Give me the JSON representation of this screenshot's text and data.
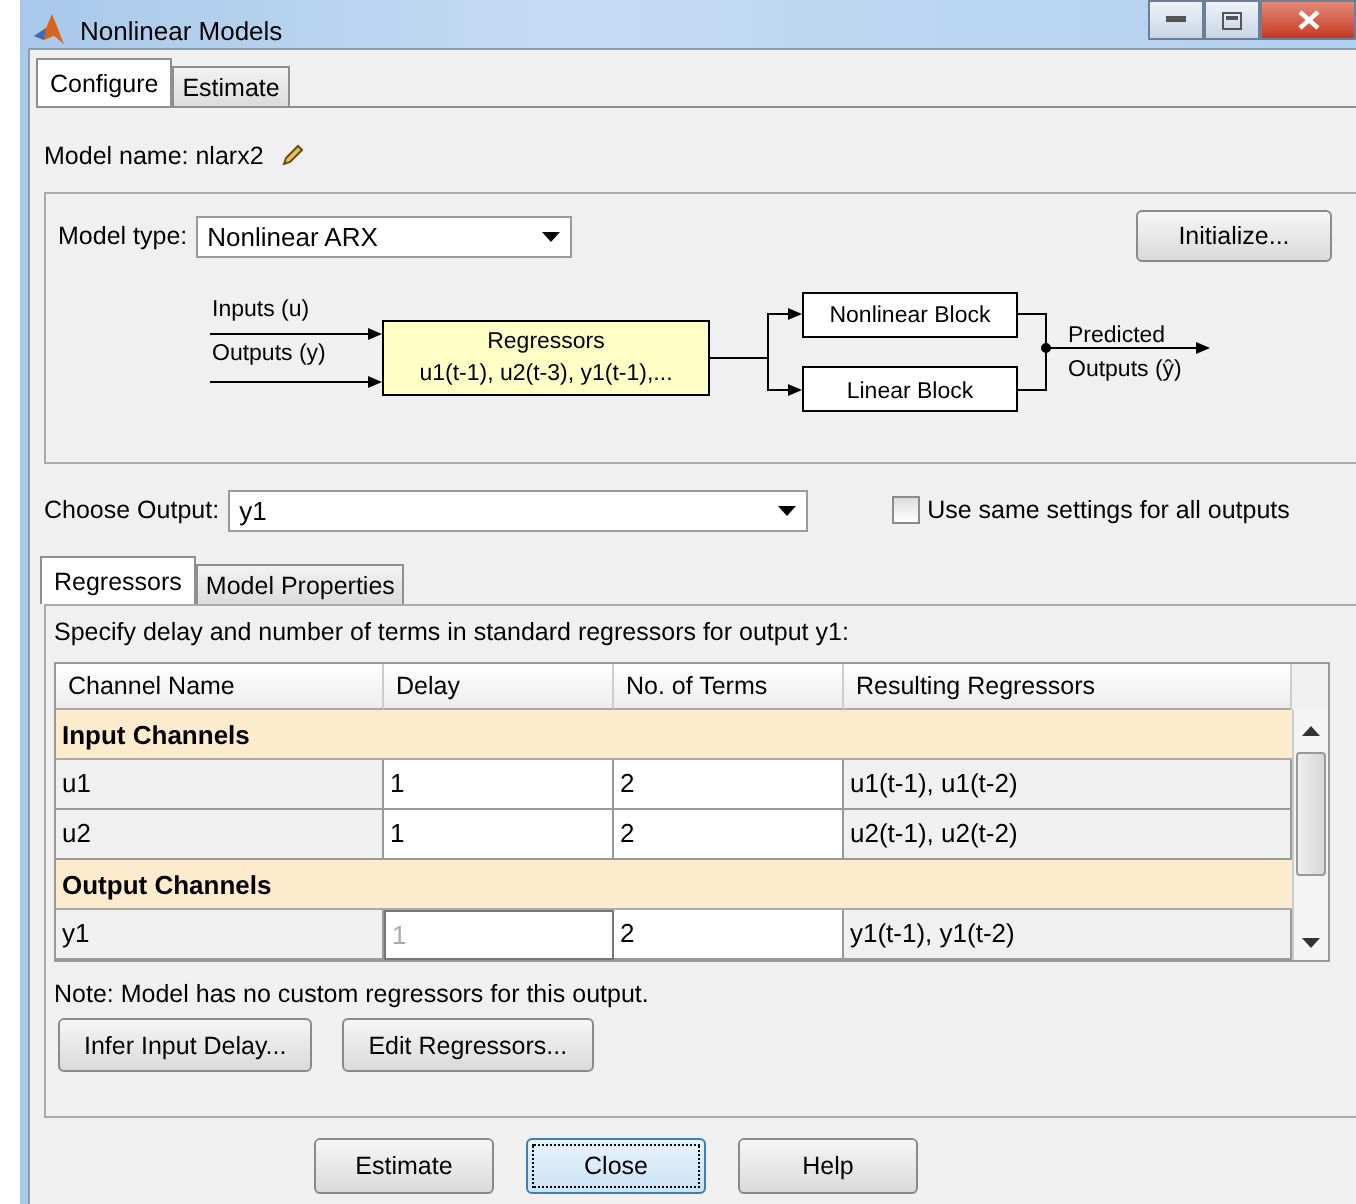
{
  "window": {
    "title": "Nonlinear Models"
  },
  "tabs": [
    {
      "label": "Configure",
      "selected": true
    },
    {
      "label": "Estimate",
      "selected": false
    }
  ],
  "model_name": {
    "label": "Model name: nlarx2"
  },
  "model_type": {
    "label": "Model type:",
    "value": "Nonlinear ARX"
  },
  "initialize_button": "Initialize...",
  "diagram": {
    "inputs": "Inputs (u)",
    "outputs": "Outputs (y)",
    "regressors_title": "Regressors",
    "regressors_list": "u1(t-1), u2(t-3), y1(t-1),...",
    "nonlinear_block": "Nonlinear Block",
    "linear_block": "Linear Block",
    "predicted_1": "Predicted",
    "predicted_2": "Outputs (ŷ)"
  },
  "choose_output": {
    "label": "Choose Output:",
    "value": "y1"
  },
  "same_settings": {
    "label": "Use same settings for all outputs",
    "checked": false
  },
  "inner_tabs": [
    {
      "label": "Regressors",
      "selected": true
    },
    {
      "label": "Model Properties",
      "selected": false
    }
  ],
  "instruction": "Specify delay and number of terms in standard regressors for output y1:",
  "table": {
    "columns": [
      "Channel Name",
      "Delay",
      "No. of Terms",
      "Resulting Regressors"
    ],
    "rows": [
      {
        "kind": "group",
        "label": "Input Channels"
      },
      {
        "kind": "channel",
        "name": "u1",
        "delay": "1",
        "delay_disabled": false,
        "terms": "2",
        "result": "u1(t-1), u1(t-2)"
      },
      {
        "kind": "channel",
        "name": "u2",
        "delay": "1",
        "delay_disabled": false,
        "terms": "2",
        "result": "u2(t-1), u2(t-2)"
      },
      {
        "kind": "group",
        "label": "Output Channels"
      },
      {
        "kind": "channel",
        "name": "y1",
        "delay": "1",
        "delay_disabled": true,
        "terms": "2",
        "result": "y1(t-1), y1(t-2)"
      }
    ]
  },
  "note": "Note: Model has no custom regressors for this output.",
  "panel_buttons": [
    "Infer Input Delay...",
    "Edit Regressors..."
  ],
  "buttons": [
    {
      "label": "Estimate",
      "focused": false
    },
    {
      "label": "Close",
      "focused": true
    },
    {
      "label": "Help",
      "focused": false
    }
  ]
}
